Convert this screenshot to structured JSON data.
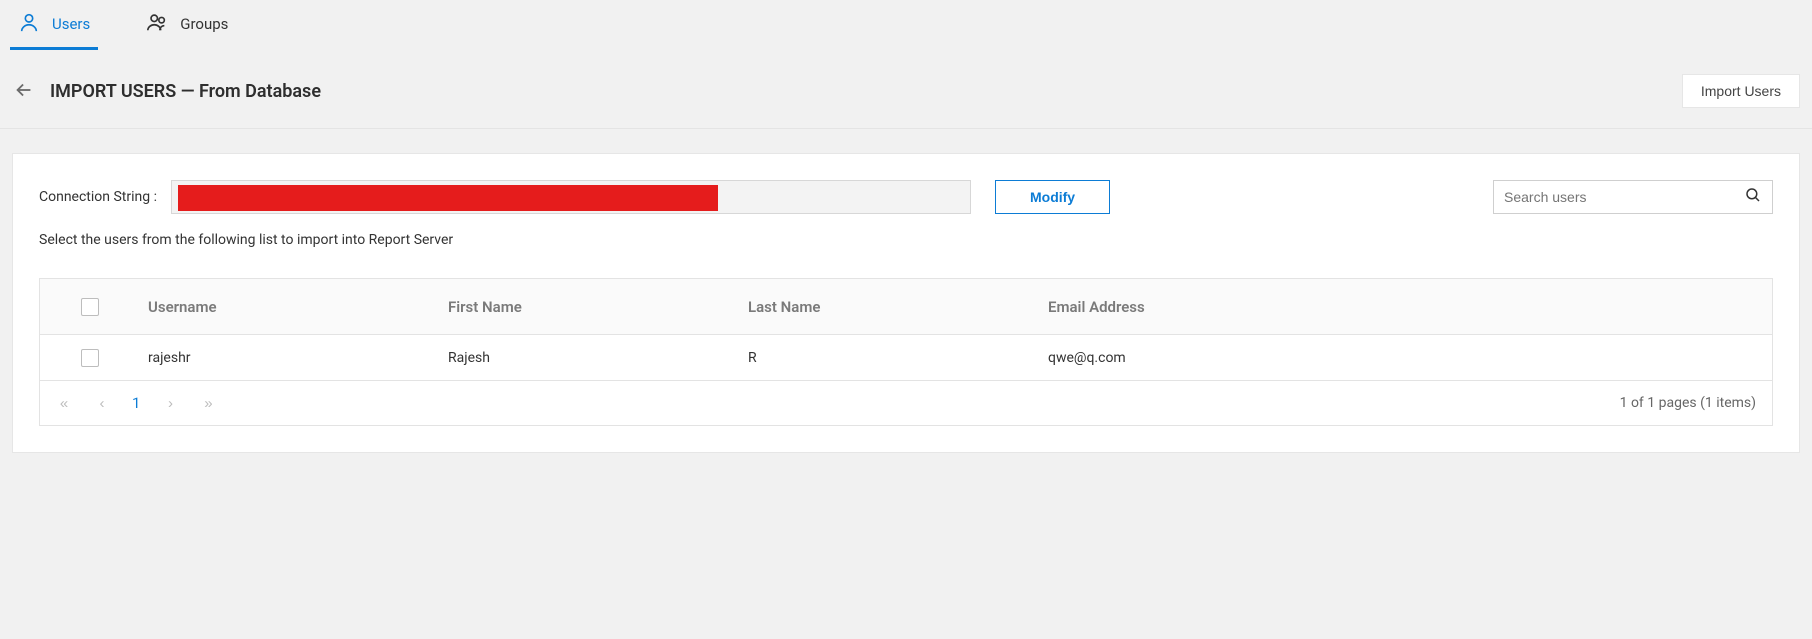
{
  "tabs": {
    "users": "Users",
    "groups": "Groups"
  },
  "header": {
    "title": "IMPORT USERS — From Database",
    "import_button": "Import Users"
  },
  "conn": {
    "label": "Connection String :",
    "modify": "Modify",
    "search_placeholder": "Search users"
  },
  "instruction": "Select the users from the following list to import into Report Server",
  "table": {
    "columns": {
      "username": "Username",
      "first_name": "First Name",
      "last_name": "Last Name",
      "email": "Email Address"
    },
    "rows": [
      {
        "username": "rajeshr",
        "first_name": "Rajesh",
        "last_name": "R",
        "email": "qwe@q.com"
      }
    ]
  },
  "pager": {
    "current": "1",
    "summary": "1 of 1 pages (1 items)"
  }
}
